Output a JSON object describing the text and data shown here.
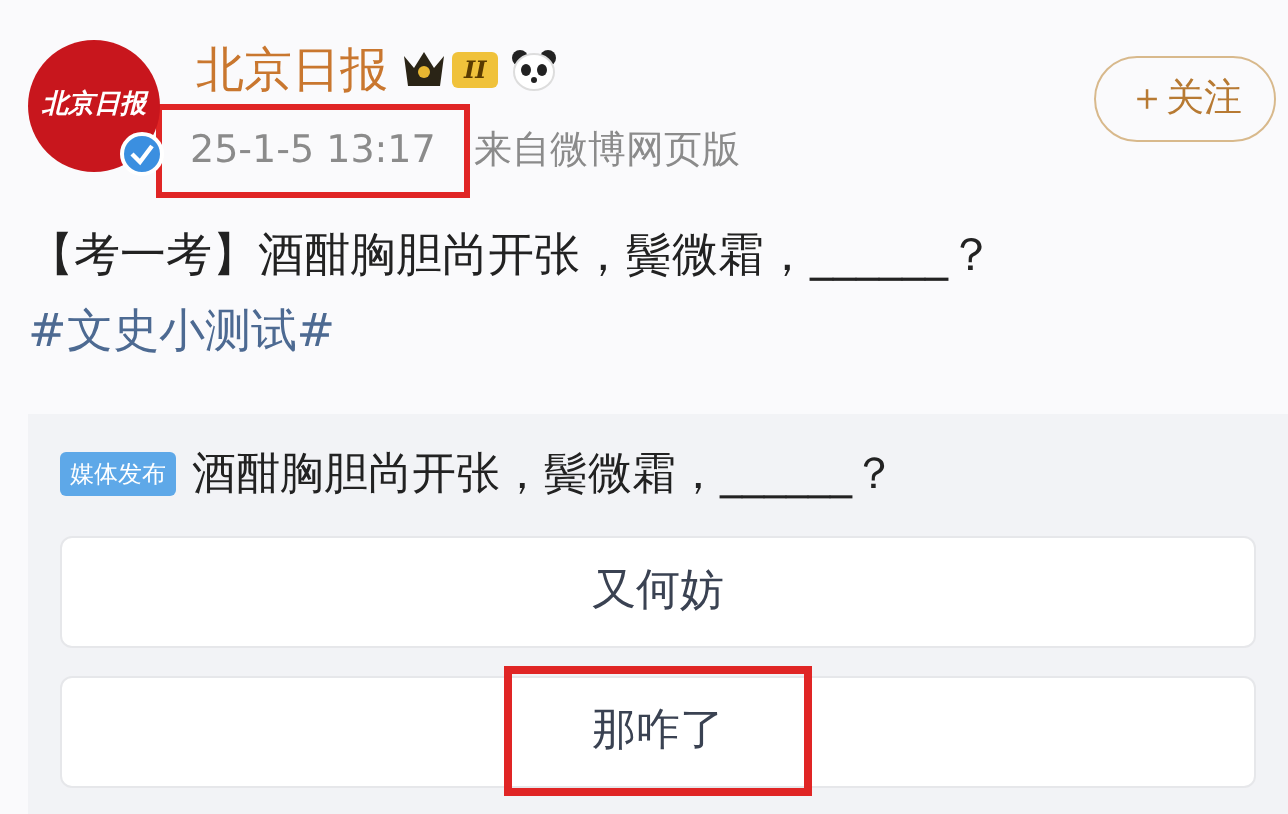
{
  "author": {
    "name": "北京日报",
    "avatar_text": "北京日报",
    "verified": true,
    "level_badge": "II"
  },
  "follow_button": "＋关注",
  "meta": {
    "time": "25-1-5 13:17",
    "source": "来自微博网页版",
    "highlighted": true
  },
  "post": {
    "text": "【考一考】酒酣胸胆尚开张，鬓微霜，______？",
    "hashtag": "#文史小测试#"
  },
  "quiz": {
    "badge": "媒体发布",
    "question": "酒酣胸胆尚开张，鬓微霜，______？",
    "options": [
      {
        "label": "又何妨",
        "highlighted": false
      },
      {
        "label": "那咋了",
        "highlighted": true
      }
    ]
  }
}
